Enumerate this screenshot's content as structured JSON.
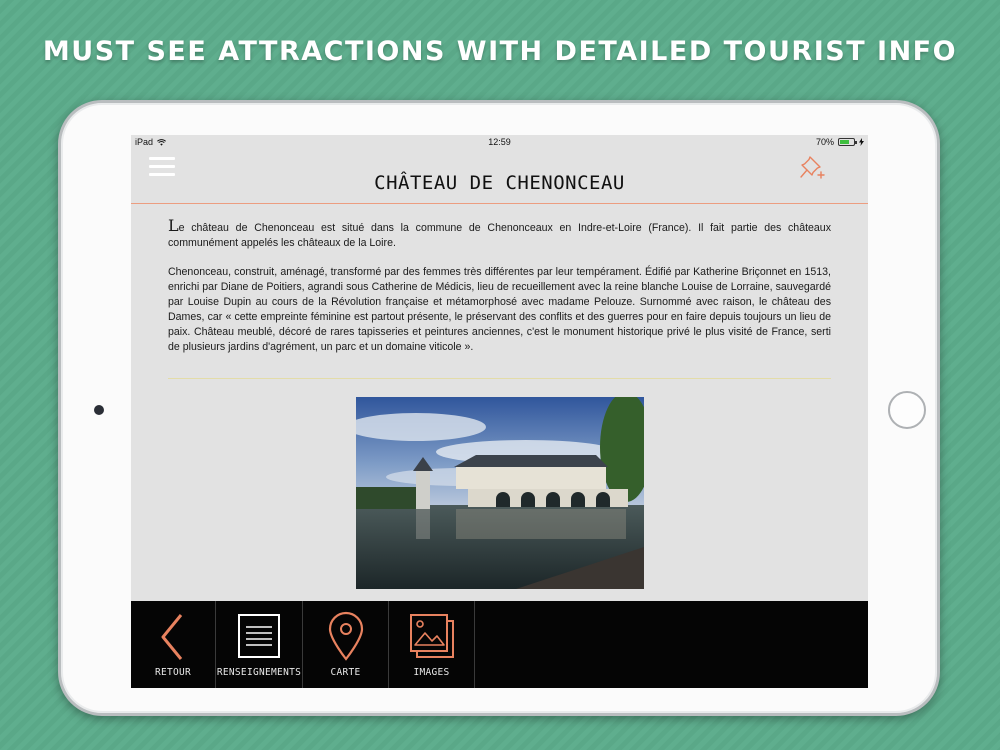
{
  "promo": {
    "headline": "MUST SEE ATTRACTIONS WITH DETAILED TOURIST INFO"
  },
  "status_bar": {
    "device": "iPad",
    "time": "12:59",
    "battery": "70%"
  },
  "nav": {
    "title": "CHÂTEAU DE CHENONCEAU",
    "menu_icon": "hamburger-menu-icon",
    "pin_icon": "pushpin-icon"
  },
  "article": {
    "p1_dropcap": "L",
    "p1_rest": "e château de Chenonceau est situé dans la commune de Chenonceaux en Indre-et-Loire (France). Il fait partie des châteaux communément appelés les châteaux de la Loire.",
    "p2": "Chenonceau, construit, aménagé, transformé par des femmes très différentes par leur tempérament. Édifié par Katherine Briçonnet en 1513, enrichi par Diane de Poitiers, agrandi sous Catherine de Médicis, lieu de recueillement avec la reine blanche Louise de Lorraine, sauvegardé par Louise Dupin au cours de la Révolution française et métamorphosé avec madame Pelouze. Surnommé avec raison, le château des Dames, car « cette empreinte féminine est partout présente, le préservant des conflits et des guerres pour en faire depuis toujours un lieu de paix. Château meublé, décoré de rares tapisseries et peintures anciennes, c'est le monument historique privé le plus visité de France, serti de plusieurs jardins d'agrément, un parc et un domaine viticole »."
  },
  "toolbar": {
    "items": [
      {
        "label": "RETOUR",
        "icon": "chevron-left-icon"
      },
      {
        "label": "RENSEIGNEMENTS",
        "icon": "document-icon"
      },
      {
        "label": "CARTE",
        "icon": "map-pin-icon"
      },
      {
        "label": "IMAGES",
        "icon": "images-icon"
      }
    ]
  },
  "colors": {
    "accent": "#e8825f",
    "background_green": "#5fae8e",
    "toolbar_bg": "#050505"
  }
}
